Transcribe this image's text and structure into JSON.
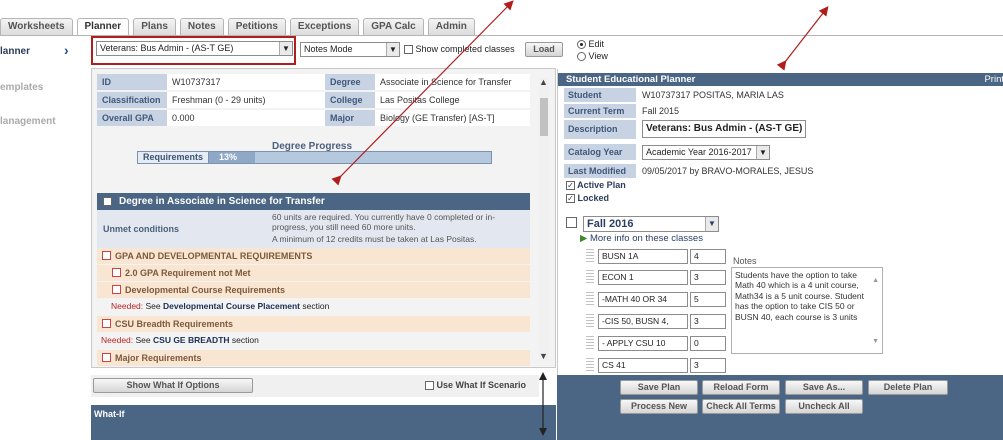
{
  "tabs": [
    {
      "label": "Worksheets"
    },
    {
      "label": "Planner"
    },
    {
      "label": "Plans"
    },
    {
      "label": "Notes"
    },
    {
      "label": "Petitions"
    },
    {
      "label": "Exceptions"
    },
    {
      "label": "GPA Calc"
    },
    {
      "label": "Admin"
    }
  ],
  "nav": {
    "planner": "lanner",
    "templates": "emplates",
    "management": "lanagement",
    "active_chevron": "›"
  },
  "controls": {
    "plan_select": "Veterans: Bus Admin - (AS-T GE)",
    "mode_select": "Notes Mode",
    "show_completed": "Show completed classes",
    "load": "Load",
    "edit": "Edit",
    "view": "View"
  },
  "student_info": {
    "id_label": "ID",
    "id": "W10737317",
    "degree_label": "Degree",
    "degree": "Associate in Science for Transfer",
    "class_label": "Classification",
    "classification": "Freshman (0 - 29 units)",
    "college_label": "College",
    "college": "Las Positas College",
    "gpa_label": "Overall GPA",
    "gpa": "0.000",
    "major_label": "Major",
    "major": "Biology (GE Transfer) [AS-T]"
  },
  "progress": {
    "title": "Degree Progress",
    "label": "Requirements",
    "percent_text": "13%",
    "percent": 13
  },
  "degree_block": {
    "title": "Degree in Associate in Science for Transfer",
    "unmet_label": "Unmet conditions",
    "unmet_line1": "60 units are required. You currently have 0 completed or in-progress, you still need 60 more units.",
    "unmet_line2": "A minimum of 12 credits must be taken at Las Positas."
  },
  "requirements": [
    {
      "label": "GPA AND DEVELOPMENTAL REQUIREMENTS"
    },
    {
      "label": "2.0 GPA Requirement not Met"
    },
    {
      "label": "Developmental Course Requirements"
    },
    {
      "needed": "Needed:",
      "see": "See",
      "link": "Developmental Course Placement",
      "suffix": "section"
    },
    {
      "label": "CSU Breadth Requirements"
    },
    {
      "needed": "Needed:",
      "see": "See",
      "link": "CSU GE BREADTH",
      "suffix": "section"
    },
    {
      "label": "Major Requirements"
    }
  ],
  "whatif": {
    "show_options": "Show What If Options",
    "use_scenario": "Use What If Scenario",
    "heading": "What-If"
  },
  "planner": {
    "title": "Student Educational Planner",
    "print": "Print",
    "student_label": "Student",
    "student": "W10737317 POSITAS, MARIA LAS",
    "term_label": "Current Term",
    "term": "Fall 2015",
    "desc_label": "Description",
    "description": "Veterans: Bus Admin - (AS-T GE)",
    "catalog_label": "Catalog Year",
    "catalog": "Academic Year 2016-2017",
    "modified_label": "Last Modified",
    "modified": "09/05/2017 by BRAVO-MORALES, JESUS",
    "active_plan": "Active Plan",
    "locked": "Locked"
  },
  "term_block": {
    "term": "Fall 2016",
    "more_info": "More info on these classes",
    "courses": [
      {
        "course": "BUSN 1A",
        "units": "4"
      },
      {
        "course": "ECON 1",
        "units": "3"
      },
      {
        "course": "-MATH 40 OR 34",
        "units": "5"
      },
      {
        "course": "-CIS 50, BUSN 4,",
        "units": "3"
      },
      {
        "course": "- APPLY CSU 10",
        "units": "0"
      },
      {
        "course": "CS 41",
        "units": "3"
      }
    ],
    "notes_label": "Notes",
    "notes_text": "Students have the option to take Math 40 which is a 4 unit course, Math34 is a 5 unit course. Student has the option to take CIS 50 or BUSN 40, each course is  3 units"
  },
  "actions": {
    "save_plan": "Save Plan",
    "reload_form": "Reload Form",
    "save_as": "Save As...",
    "delete_plan": "Delete Plan",
    "process_new": "Process New",
    "check_all_terms": "Check All Terms",
    "uncheck_all": "Uncheck All"
  },
  "colors": {
    "header_blue": "#4b6585",
    "label_blue": "#c7d3e3",
    "requirement_tan": "#f8e5d2",
    "annotation_red": "#b11d1d"
  }
}
